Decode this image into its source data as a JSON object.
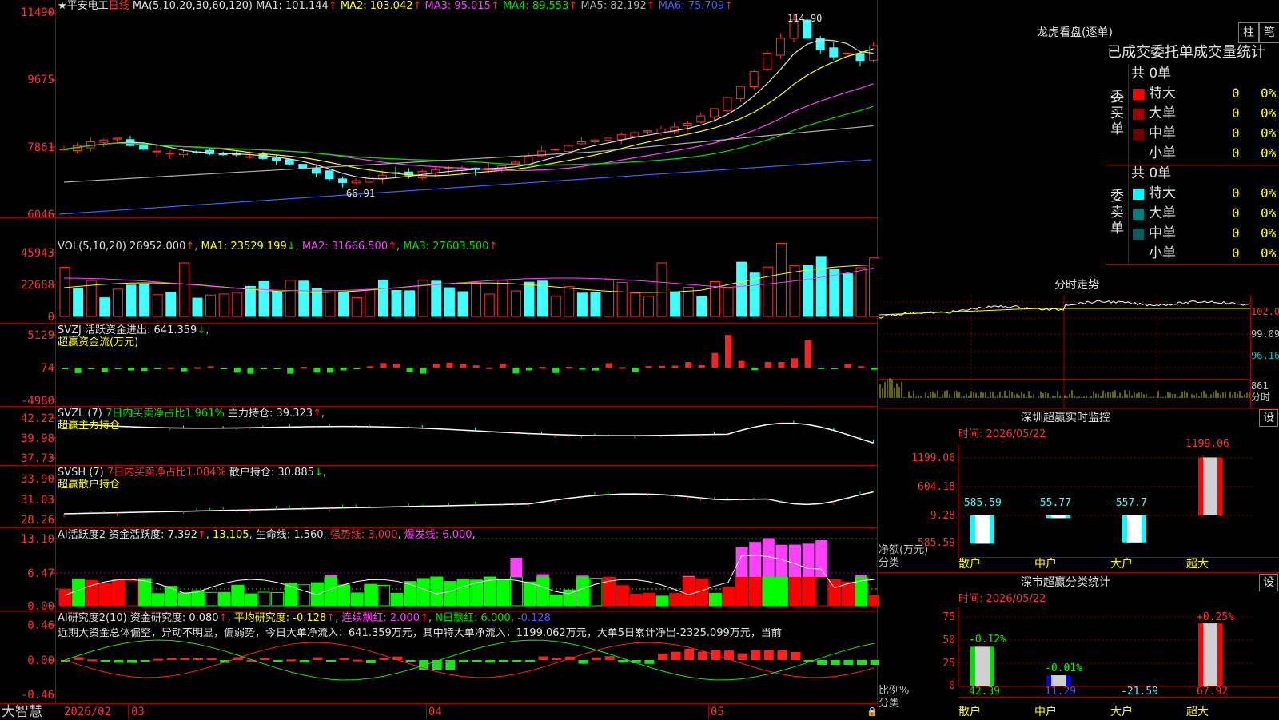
{
  "main": {
    "stock_star": "★",
    "stock_name": "平安电工",
    "period": "日线",
    "ma_params": "MA(5,10,20,30,60,120)",
    "ma": [
      {
        "label": "MA1:",
        "value": "101.144",
        "arrow": "↑",
        "color": "#e0e0e0"
      },
      {
        "label": "MA2:",
        "value": "103.042",
        "arrow": "↑",
        "color": "#ffff00"
      },
      {
        "label": "MA3:",
        "value": "95.015",
        "arrow": "↑",
        "color": "#ff40ff"
      },
      {
        "label": "MA4:",
        "value": "89.553",
        "arrow": "↑",
        "color": "#00e000"
      },
      {
        "label": "MA5:",
        "value": "82.192",
        "arrow": "↑",
        "color": "#b0b0b0"
      },
      {
        "label": "MA6:",
        "value": "75.709",
        "arrow": "↑",
        "color": "#4060ff"
      }
    ],
    "y_labels": [
      "11490",
      "9675",
      "7861",
      "6046"
    ],
    "high_mark": "114.90",
    "low_mark": "66.91"
  },
  "vol": {
    "params": "VOL(5,10,20)",
    "value": "26952.000",
    "arrow": "↑",
    "ma1": "MA1: 23529.199",
    "ma1_arrow": "↓",
    "ma2": "MA2: 31666.500",
    "ma2_arrow": "↑",
    "ma3": "MA3: 27603.500",
    "ma3_arrow": "↑",
    "y_labels": [
      "45943",
      "22688",
      "0"
    ]
  },
  "svzj": {
    "name": "SVZJ",
    "line1": "活跃资金进出: 641.359",
    "arrow": "↓",
    "sub": "超赢资金流(万元)",
    "y_labels": [
      "5129",
      "74",
      "-4980"
    ]
  },
  "svzl": {
    "name": "SVZL  (7)",
    "txt1": "7日内买卖净占比1.961%",
    "txt2": "主力持仓: 39.323",
    "arrow": "↑",
    "sub": "超赢主力持仓",
    "y_labels": [
      "42.22",
      "39.98",
      "37.73"
    ]
  },
  "svsh": {
    "name": "SVSH  (7)",
    "txt1": "7日内买卖净占比1.084%",
    "txt2": "散户持仓: 30.885",
    "arrow": "↓",
    "sub": "超赢散户持仓",
    "y_labels": [
      "33.90",
      "31.03",
      "28.26"
    ]
  },
  "ai1": {
    "name": "AI活跃度2",
    "v1": "资金活跃度: 7.392",
    "a1": "↑",
    "v2": "13.105",
    "v3": "生命线: 1.560",
    "v4": "强势线: 3.000",
    "v5": "爆发线: 6.000",
    "y_labels": [
      "13.10",
      "6.47",
      "0.00"
    ]
  },
  "ai2": {
    "name": "AI研究度2(10)",
    "v1": "资金研究度: 0.080",
    "a1": "↑",
    "v2": "平均研究度: -0.128",
    "a2": "↑",
    "v3": "连续飘红: 2.000",
    "a3": "↑",
    "v4": "N日飘红: 6.000",
    "v5": "-0.128",
    "comment": "近期大资金总体偏空，异动不明显，偏弱势，今日大单净流入：641.359万元，其中特大单净流入：1199.062万元，大单5日累计净出-2325.099万元，当前",
    "y_labels": [
      "0.46",
      "0.00",
      "-0.46"
    ]
  },
  "bottom": {
    "brand": "大智慧",
    "dates": [
      "2026/02",
      "03",
      "04",
      "05"
    ]
  },
  "right": {
    "lhb_title": "龙虎看盘(逐单)",
    "btn_zhu": "柱",
    "btn_bi": "笔",
    "stat_title": "已成交委托单成交量统计",
    "buy_label": "委买单",
    "sell_label": "委卖单",
    "buy_total": "共 0单",
    "sell_total": "共 0单",
    "buy_rows": [
      {
        "name": "特大",
        "val": "0",
        "pct": "0%",
        "color": "#ff0000"
      },
      {
        "name": "大单",
        "val": "0",
        "pct": "0%",
        "color": "#a00000"
      },
      {
        "name": "中单",
        "val": "0",
        "pct": "0%",
        "color": "#700000"
      },
      {
        "name": "小单",
        "val": "0",
        "pct": "0%",
        "color": "#000000"
      }
    ],
    "sell_rows": [
      {
        "name": "特大",
        "val": "0",
        "pct": "0%",
        "color": "#00ffff"
      },
      {
        "name": "大单",
        "val": "0",
        "pct": "0%",
        "color": "#008080"
      },
      {
        "name": "中单",
        "val": "0",
        "pct": "0%",
        "color": "#006060"
      },
      {
        "name": "小单",
        "val": "0",
        "pct": "0%",
        "color": "#000000"
      }
    ],
    "fs_title": "分时走势",
    "fs_y": [
      "102.0",
      "99.09",
      "96.16"
    ],
    "fs_vol": "861",
    "fs_vol_label": "分时",
    "sz_title": "深圳超赢实时监控",
    "sz_time": "时间: 2026/05/22",
    "sz_btn": "设",
    "sz_y": [
      "1199.06",
      "604.18",
      "9.28",
      "-585.59"
    ],
    "sz_unit": "净额(万元)",
    "sz_cat_label": "分类",
    "sz_cats": [
      "散户",
      "中户",
      "大户",
      "超大"
    ],
    "sz_vals": [
      "-585.59",
      "-55.77",
      "-557.7",
      "1199.06"
    ],
    "cls_title": "深市超赢分类统计",
    "cls_time": "时间: 2026/05/22",
    "cls_btn": "设",
    "cls_y": [
      "75",
      "50",
      "25",
      "0"
    ],
    "cls_top": [
      "-0.12%",
      "-0.01%",
      "",
      "+0.25%"
    ],
    "cls_bottom": [
      "42.39",
      "11.29",
      "-21.59",
      "67.92"
    ],
    "cls_unit": "比例%",
    "cls_cat_label": "分类",
    "cls_cats": [
      "散户",
      "中户",
      "大户",
      "超大"
    ]
  },
  "chart_data": [
    {
      "type": "candlestick",
      "title": "平安电工 日线",
      "ylabel": "",
      "y_ticks": [
        6046,
        7861,
        9675,
        11490
      ],
      "high": 114.9,
      "low": 66.91,
      "note_dates": [
        "2026/02",
        "03",
        "04",
        "05"
      ]
    },
    {
      "type": "bar",
      "name": "VOL",
      "y_ticks": [
        0,
        22688,
        45943
      ]
    },
    {
      "type": "bar",
      "name": "SVZJ",
      "y_ticks": [
        -4980,
        74,
        5129
      ]
    },
    {
      "type": "line",
      "name": "SVZL",
      "y_ticks": [
        37.73,
        39.98,
        42.22
      ]
    },
    {
      "type": "line",
      "name": "SVSH",
      "y_ticks": [
        28.26,
        31.03,
        33.9
      ]
    },
    {
      "type": "bar",
      "name": "AI活跃度2",
      "y_ticks": [
        0.0,
        6.47,
        13.1
      ]
    },
    {
      "type": "bar",
      "name": "AI研究度2",
      "y_ticks": [
        -0.46,
        0.0,
        0.46
      ]
    },
    {
      "type": "bar",
      "name": "深圳超赢实时监控",
      "categories": [
        "散户",
        "中户",
        "大户",
        "超大"
      ],
      "values": [
        -585.59,
        -55.77,
        -557.7,
        1199.06
      ]
    },
    {
      "type": "bar",
      "name": "深市超赢分类统计",
      "categories": [
        "散户",
        "中户",
        "大户",
        "超大"
      ],
      "values": [
        42.39,
        11.29,
        -21.59,
        67.92
      ]
    }
  ]
}
